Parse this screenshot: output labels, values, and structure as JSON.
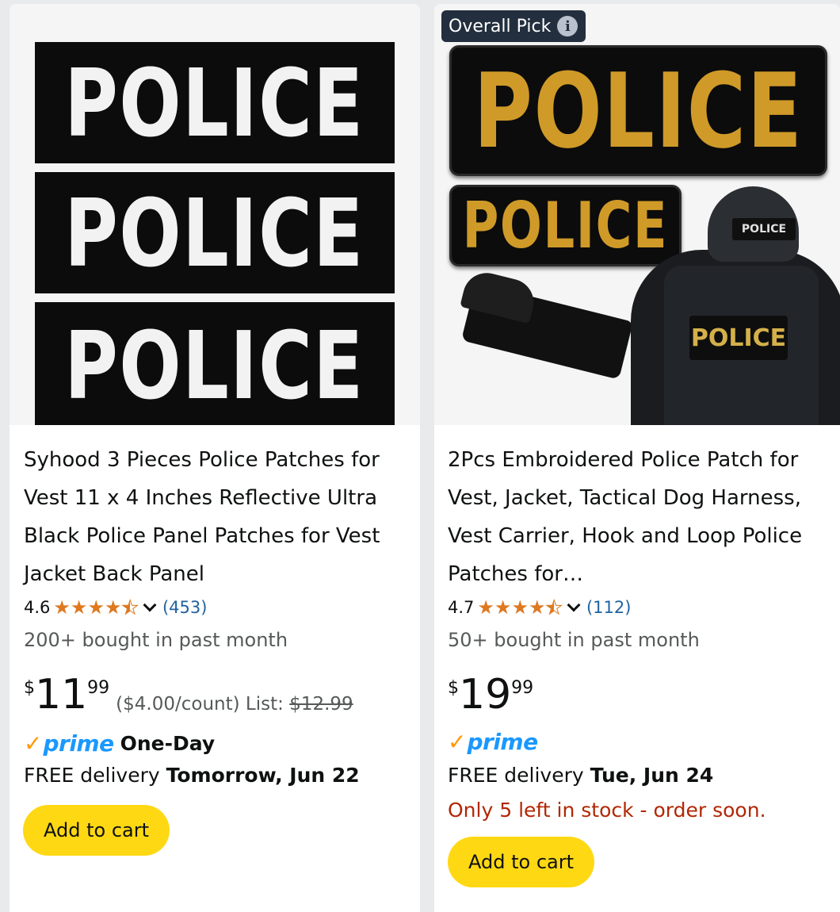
{
  "products": [
    {
      "image": {
        "patches": [
          "POLICE",
          "POLICE",
          "POLICE"
        ],
        "patch_text_color": "#f2f2f2",
        "patch_bg_color": "#0c0c0c"
      },
      "title": "Syhood 3 Pieces Police Patches for Vest 11 x 4 Inches Reflective Ultra Black Police Panel Patches for Vest Jacket Back Panel",
      "rating": "4.6",
      "stars": 4.5,
      "review_count": "(453)",
      "bought": "200+ bought in past month",
      "price": {
        "currency": "$",
        "whole": "11",
        "fraction": "99"
      },
      "unit_price": "($4.00/count) List: ",
      "list_price": "$12.99",
      "prime": {
        "check": "✓",
        "label": "prime",
        "extra": "One-Day"
      },
      "delivery": {
        "prefix": "FREE delivery ",
        "date": "Tomorrow, Jun 22"
      },
      "add_to_cart": "Add to cart"
    },
    {
      "badge": {
        "label": "Overall Pick",
        "icon": "info-icon",
        "glyph": "i"
      },
      "image": {
        "patch_large": "POLICE",
        "patch_small": "POLICE",
        "helmet_label": "POLICE",
        "vest_label": "POLICE",
        "patch_text_color": "#cf9a28"
      },
      "title": "2Pcs Embroidered Police Patch for Vest, Jacket, Tactical Dog Harness, Vest Carrier, Hook and Loop Police Patches for…",
      "rating": "4.7",
      "stars": 4.5,
      "review_count": "(112)",
      "bought": "50+ bought in past month",
      "price": {
        "currency": "$",
        "whole": "19",
        "fraction": "99"
      },
      "prime": {
        "check": "✓",
        "label": "prime"
      },
      "delivery": {
        "prefix": "FREE delivery ",
        "date": "Tue, Jun 24"
      },
      "stock": "Only 5 left in stock - order soon.",
      "add_to_cart": "Add to cart"
    }
  ],
  "colors": {
    "star": "#de7921",
    "link": "#2162a1",
    "prime": "#1a98ff",
    "prime_check": "#ff9900",
    "cart_button": "#ffd814",
    "stock_warning": "#b12704",
    "badge_bg": "#232f3e"
  }
}
